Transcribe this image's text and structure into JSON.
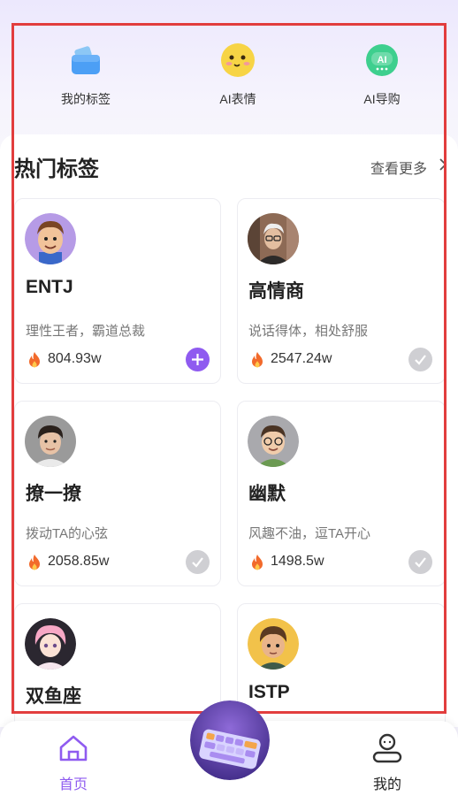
{
  "quick_actions": [
    {
      "label": "我的标签",
      "icon": "wallet-icon"
    },
    {
      "label": "AI表情",
      "icon": "emoji-icon"
    },
    {
      "label": "AI导购",
      "icon": "ai-bot-icon"
    }
  ],
  "hot_tags": {
    "title": "热门标签",
    "more_label": "查看更多",
    "cards": [
      {
        "name": "ENTJ",
        "desc": "理性王者，霸道总裁",
        "count": "804.93w",
        "action": "add"
      },
      {
        "name": "高情商",
        "desc": "说话得体，相处舒服",
        "count": "2547.24w",
        "action": "added"
      },
      {
        "name": "撩一撩",
        "desc": "拨动TA的心弦",
        "count": "2058.85w",
        "action": "added"
      },
      {
        "name": "幽默",
        "desc": "风趣不油，逗TA开心",
        "count": "1498.5w",
        "action": "added"
      },
      {
        "name": "双鱼座",
        "desc": "",
        "count": "",
        "action": ""
      },
      {
        "name": "ISTP",
        "desc": "",
        "count": "",
        "action": ""
      }
    ]
  },
  "bottom_nav": {
    "home_label": "首页",
    "mine_label": "我的",
    "active_color": "#8f5bf0"
  }
}
